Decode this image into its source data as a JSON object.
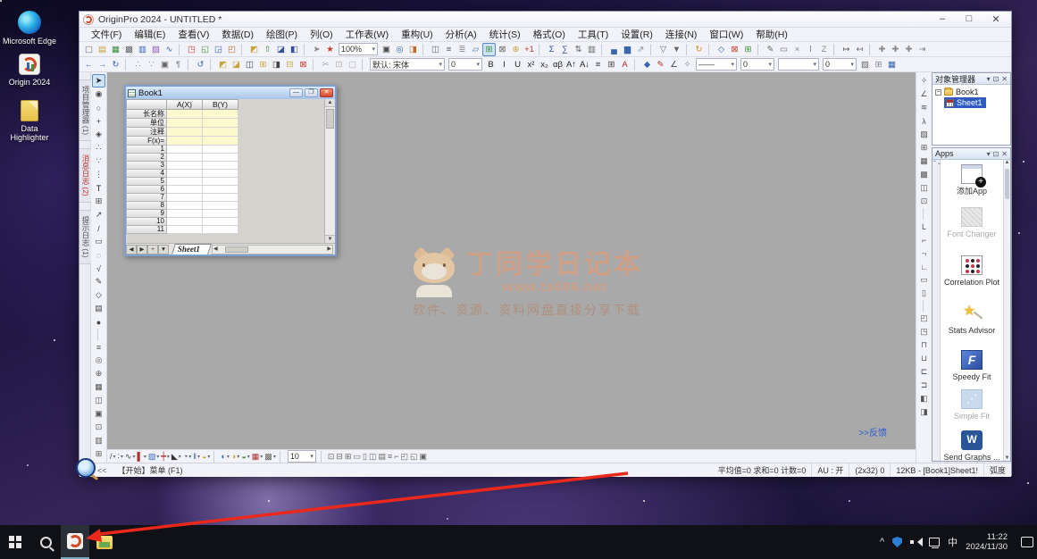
{
  "desktop": {
    "icons": [
      {
        "label": "Microsoft Edge"
      },
      {
        "label": "Origin 2024"
      },
      {
        "label": "Data Highlighter"
      }
    ]
  },
  "app": {
    "title": "OriginPro 2024 - UNTITLED *",
    "window_controls": {
      "minimize": "–",
      "maximize": "□",
      "close": "✕"
    },
    "menus": [
      "文件(F)",
      "编辑(E)",
      "查看(V)",
      "数据(D)",
      "绘图(P)",
      "列(O)",
      "工作表(W)",
      "重构(U)",
      "分析(A)",
      "统计(S)",
      "格式(O)",
      "工具(T)",
      "设置(R)",
      "连接(N)",
      "窗口(W)",
      "帮助(H)"
    ],
    "toolbar1a": [
      {
        "g": "▢",
        "c": "#666"
      },
      {
        "g": "▤",
        "c": "#c8a23a"
      },
      {
        "g": "▦",
        "c": "#3e8e3e"
      },
      {
        "g": "▩",
        "c": "#666"
      },
      {
        "g": "▥",
        "c": "#3a66b0"
      },
      {
        "g": "▨",
        "c": "#8a5ab0"
      },
      {
        "g": "∿",
        "c": "#3a66b0"
      },
      "|",
      {
        "g": "◳",
        "c": "#c23a2a"
      },
      {
        "g": "◱",
        "c": "#3e8e3e"
      },
      {
        "g": "◲",
        "c": "#3a66b0"
      },
      {
        "g": "◰",
        "c": "#b06a2a"
      },
      "|",
      {
        "g": "◩",
        "c": "#c8a23a"
      },
      {
        "g": "⇧",
        "c": "#3e8e3e"
      },
      {
        "g": "◪",
        "c": "#34509a"
      },
      {
        "g": "◧",
        "c": "#34509a"
      },
      "|",
      {
        "g": "➤",
        "c": "#888"
      },
      {
        "g": "★",
        "c": "#c23a2a"
      }
    ],
    "zoom_value": "100%",
    "toolbar1b": [
      {
        "g": "▣",
        "c": "#4a4a4a"
      },
      {
        "g": "◎",
        "c": "#3a66b0"
      },
      {
        "g": "◨",
        "c": "#c06a2a"
      },
      "|",
      {
        "g": "◫",
        "c": "#666"
      },
      {
        "g": "≡",
        "c": "#666"
      },
      {
        "g": "≣",
        "c": "#999"
      },
      {
        "g": "▱",
        "c": "#3a66b0"
      },
      {
        "g": "⊞",
        "c": "#3e8e3e",
        "sel": true
      },
      {
        "g": "⊠",
        "c": "#666"
      },
      {
        "g": "⊕",
        "c": "#c8a23a"
      },
      {
        "g": "+1",
        "c": "#c23a2a"
      },
      "|",
      {
        "g": "Σ",
        "c": "#34509a"
      },
      {
        "g": "∑",
        "c": "#34509a"
      },
      {
        "g": "⇅",
        "c": "#666"
      },
      {
        "g": "▥",
        "c": "#666"
      },
      "|",
      {
        "g": "▄",
        "c": "#3a66b0"
      },
      {
        "g": "▆",
        "c": "#3a66b0"
      },
      {
        "g": "⇗",
        "c": "#888"
      },
      "|",
      {
        "g": "▽",
        "c": "#666"
      },
      {
        "g": "▼",
        "c": "#666"
      },
      "|",
      {
        "g": "↻",
        "c": "#d88c2a"
      },
      "|",
      {
        "g": "◇",
        "c": "#3a66b0"
      },
      {
        "g": "⊠",
        "c": "#c23a2a"
      },
      {
        "g": "⊞",
        "c": "#3e8e3e"
      },
      "|",
      {
        "g": "✎",
        "c": "#666"
      },
      {
        "g": "▭",
        "c": "#666"
      },
      {
        "g": "×",
        "c": "#888"
      },
      {
        "g": "Ⅰ",
        "c": "#888"
      },
      {
        "g": "Z",
        "c": "#888"
      },
      "|",
      {
        "g": "↦",
        "c": "#666"
      },
      {
        "g": "↤",
        "c": "#666"
      },
      "|",
      {
        "g": "✚",
        "c": "#888"
      },
      {
        "g": "✚",
        "c": "#888"
      },
      {
        "g": "✚",
        "c": "#888"
      },
      {
        "g": "⇥",
        "c": "#888"
      }
    ],
    "toolbar2a": [
      {
        "g": "←",
        "c": "#3a66b0"
      },
      {
        "g": "→",
        "c": "#3a66b0"
      },
      {
        "g": "↻",
        "c": "#3a66b0"
      },
      "|",
      {
        "g": "∴",
        "c": "#888"
      },
      {
        "g": "∵",
        "c": "#888"
      },
      {
        "g": "▣",
        "c": "#666"
      },
      {
        "g": "¶",
        "c": "#888"
      },
      "|",
      {
        "g": "↺",
        "c": "#3a66b0"
      },
      "|",
      {
        "g": "◩",
        "c": "#c8a23a"
      },
      {
        "g": "◪",
        "c": "#c8a23a"
      },
      {
        "g": "◫",
        "c": "#444"
      },
      {
        "g": "⊞",
        "c": "#c8a23a"
      },
      {
        "g": "◨",
        "c": "#444"
      },
      {
        "g": "⊟",
        "c": "#c8a23a"
      },
      {
        "g": "⊠",
        "c": "#c23a2a"
      },
      "|",
      {
        "g": "✂",
        "c": "#aaa"
      },
      {
        "g": "⊡",
        "c": "#aaa"
      },
      {
        "g": "▢",
        "c": "#aaa"
      },
      "|"
    ],
    "font_name": "默认: 宋体",
    "font_size": "0",
    "toolbar2b": [
      {
        "g": "B",
        "c": "#222"
      },
      {
        "g": "I",
        "c": "#222"
      },
      {
        "g": "U",
        "c": "#222"
      },
      {
        "g": "x²",
        "c": "#222"
      },
      {
        "g": "x₂",
        "c": "#222"
      },
      {
        "g": "αβ",
        "c": "#222"
      },
      {
        "g": "A↑",
        "c": "#222"
      },
      {
        "g": "A↓",
        "c": "#222"
      },
      {
        "g": "≡",
        "c": "#444"
      },
      {
        "g": "⊞",
        "c": "#444"
      },
      {
        "g": "A",
        "c": "#b03030"
      },
      "|",
      {
        "g": "◆",
        "c": "#3a66b0"
      },
      {
        "g": "✎",
        "c": "#b03030"
      },
      {
        "g": "∠",
        "c": "#444"
      },
      {
        "g": "✧",
        "c": "#888"
      }
    ],
    "line_style_value": "——",
    "line_width_value": "0",
    "line_style2_value": "",
    "line_width2_value": "0",
    "toolbar2c": [
      {
        "g": "▨",
        "c": "#666"
      },
      {
        "g": "⊞",
        "c": "#888"
      },
      {
        "g": "▦",
        "c": "#3a66b0"
      }
    ]
  },
  "left_dock": {
    "tabs": [
      {
        "label": "项目管理器 (1)",
        "color": "#555"
      },
      {
        "label": "消息日志 (2)",
        "color": "#c03030"
      },
      {
        "label": "提示日志 (1)",
        "color": "#555"
      }
    ],
    "tools": [
      {
        "g": "➤",
        "c": "#222",
        "sel": true
      },
      {
        "g": "◉",
        "c": "#444"
      },
      {
        "g": "○",
        "c": "#444"
      },
      {
        "g": "+",
        "c": "#444"
      },
      {
        "g": "◈",
        "c": "#444"
      },
      {
        "g": "∴",
        "c": "#444"
      },
      {
        "g": "∵",
        "c": "#444"
      },
      {
        "g": "⋮",
        "c": "#444"
      },
      {
        "g": "T",
        "c": "#222"
      },
      {
        "g": "⊞",
        "c": "#444"
      },
      {
        "g": "↗",
        "c": "#444"
      },
      {
        "g": "/",
        "c": "#444"
      },
      {
        "g": "▭",
        "c": "#444"
      },
      {
        "g": "◌",
        "c": "#444"
      },
      {
        "g": "√",
        "c": "#444"
      },
      {
        "g": "✎",
        "c": "#444"
      },
      {
        "g": "◇",
        "c": "#444"
      },
      {
        "g": "▤",
        "c": "#444"
      },
      {
        "g": "●",
        "c": "#444"
      },
      "|",
      {
        "g": "≡",
        "c": "#555"
      },
      {
        "g": "◎",
        "c": "#555"
      },
      {
        "g": "⊕",
        "c": "#555"
      },
      {
        "g": "▦",
        "c": "#555"
      },
      {
        "g": "◫",
        "c": "#555"
      },
      {
        "g": "▣",
        "c": "#555"
      },
      {
        "g": "⊡",
        "c": "#555"
      },
      {
        "g": "▥",
        "c": "#555"
      },
      {
        "g": "⊞",
        "c": "#555"
      }
    ]
  },
  "right_tools": [
    {
      "g": "✧",
      "c": "#555"
    },
    {
      "g": "∠",
      "c": "#555"
    },
    {
      "g": "≋",
      "c": "#555"
    },
    {
      "g": "λ",
      "c": "#555"
    },
    {
      "g": "▨",
      "c": "#555"
    },
    {
      "g": "⊞",
      "c": "#555"
    },
    {
      "g": "▦",
      "c": "#555"
    },
    {
      "g": "▩",
      "c": "#555"
    },
    {
      "g": "◫",
      "c": "#555"
    },
    {
      "g": "⊡",
      "c": "#555"
    },
    "|",
    {
      "g": "L",
      "c": "#555"
    },
    {
      "g": "⌐",
      "c": "#555"
    },
    {
      "g": "¬",
      "c": "#555"
    },
    {
      "g": "∟",
      "c": "#555"
    },
    {
      "g": "▭",
      "c": "#555"
    },
    {
      "g": "▯",
      "c": "#555"
    },
    "|",
    {
      "g": "◰",
      "c": "#555"
    },
    {
      "g": "◳",
      "c": "#555"
    },
    {
      "g": "⊓",
      "c": "#555"
    },
    {
      "g": "⊔",
      "c": "#555"
    },
    {
      "g": "⊏",
      "c": "#555"
    },
    {
      "g": "⊐",
      "c": "#555"
    },
    {
      "g": "◧",
      "c": "#555"
    },
    {
      "g": "◨",
      "c": "#555"
    }
  ],
  "book1": {
    "title": "Book1",
    "window_buttons": {
      "minimize": "—",
      "restore": "❐",
      "close": "✕"
    },
    "columns": [
      "A(X)",
      "B(Y)"
    ],
    "label_rows": [
      "长名称",
      "单位",
      "注释",
      "F(x)="
    ],
    "numbered_rows": [
      "1",
      "2",
      "3",
      "4",
      "5",
      "6",
      "7",
      "8",
      "9",
      "10",
      "11"
    ],
    "sheet_tab": "Sheet1",
    "nav_buttons": [
      "◀",
      "▶",
      "+",
      "▼"
    ]
  },
  "watermark": {
    "title": "丁同学日记本",
    "url": "www.ts006.net",
    "subtitle": "软件、资源、资料网盘直接分享下载"
  },
  "workspace": {
    "feedback_link": ">>反馈"
  },
  "object_manager": {
    "title": "对象管理器",
    "buttons": [
      "▾",
      "⊡",
      "✕"
    ],
    "root_label": "Book1",
    "sheet_label": "Sheet1"
  },
  "apps_panel": {
    "title": "Apps",
    "buttons": [
      "▾",
      "⊡",
      "✕"
    ],
    "strip_arrows": "⌃⌄",
    "items": [
      {
        "label": "添加App"
      },
      {
        "label": "Font Changer"
      },
      {
        "label": "Correlation Plot"
      },
      {
        "label": "Stats Advisor"
      },
      {
        "label": "Speedy Fit"
      },
      {
        "label": "Simple Fit"
      },
      {
        "label": "Send Graphs ..."
      }
    ]
  },
  "bottom_toolbar": {
    "plot_icons": [
      {
        "g": "/",
        "c": "#444"
      },
      {
        "g": "∶",
        "c": "#444"
      },
      {
        "g": "∿",
        "c": "#444"
      },
      {
        "g": "▌",
        "c": "#b03030"
      },
      {
        "g": "▨",
        "c": "#3a66b0"
      },
      {
        "g": "┿",
        "c": "#b03030"
      },
      {
        "g": "◣",
        "c": "#333"
      },
      {
        "g": "◔",
        "c": "#444"
      },
      {
        "g": "‖",
        "c": "#3a66b0"
      },
      {
        "g": "◒",
        "c": "#c8a23a"
      }
    ],
    "group2": [
      {
        "g": "◐",
        "c": "#3a66b0"
      },
      {
        "g": "◑",
        "c": "#c8a23a"
      },
      {
        "g": "◒",
        "c": "#3e8e3e"
      },
      {
        "g": "▦",
        "c": "#b03030"
      },
      {
        "g": "▩",
        "c": "#666"
      }
    ],
    "dropdown_value": "10",
    "group3": [
      {
        "g": "⊡",
        "c": "#666"
      },
      {
        "g": "⊟",
        "c": "#666"
      },
      {
        "g": "⊞",
        "c": "#666"
      },
      {
        "g": "▭",
        "c": "#666"
      },
      {
        "g": "▯",
        "c": "#666"
      },
      {
        "g": "◫",
        "c": "#666"
      },
      {
        "g": "▤",
        "c": "#666"
      },
      {
        "g": "≡",
        "c": "#666"
      },
      {
        "g": "⌐",
        "c": "#666"
      },
      {
        "g": "◰",
        "c": "#666"
      },
      {
        "g": "◱",
        "c": "#666"
      },
      {
        "g": "▣",
        "c": "#666"
      }
    ]
  },
  "status_bar": {
    "collapse": "<<",
    "left": "【开始】菜单 (F1)",
    "stats": "平均值=0 求和=0 计数=0",
    "au": "AU : 开",
    "dims": "(2x32) 0",
    "size_sheet": "12KB - [Book1]Sheet1!",
    "angle_unit": "弧度"
  },
  "taskbar": {
    "time": "11:22",
    "date": "2024/11/30",
    "input_indicator": "中",
    "tray_chevron": "^"
  }
}
